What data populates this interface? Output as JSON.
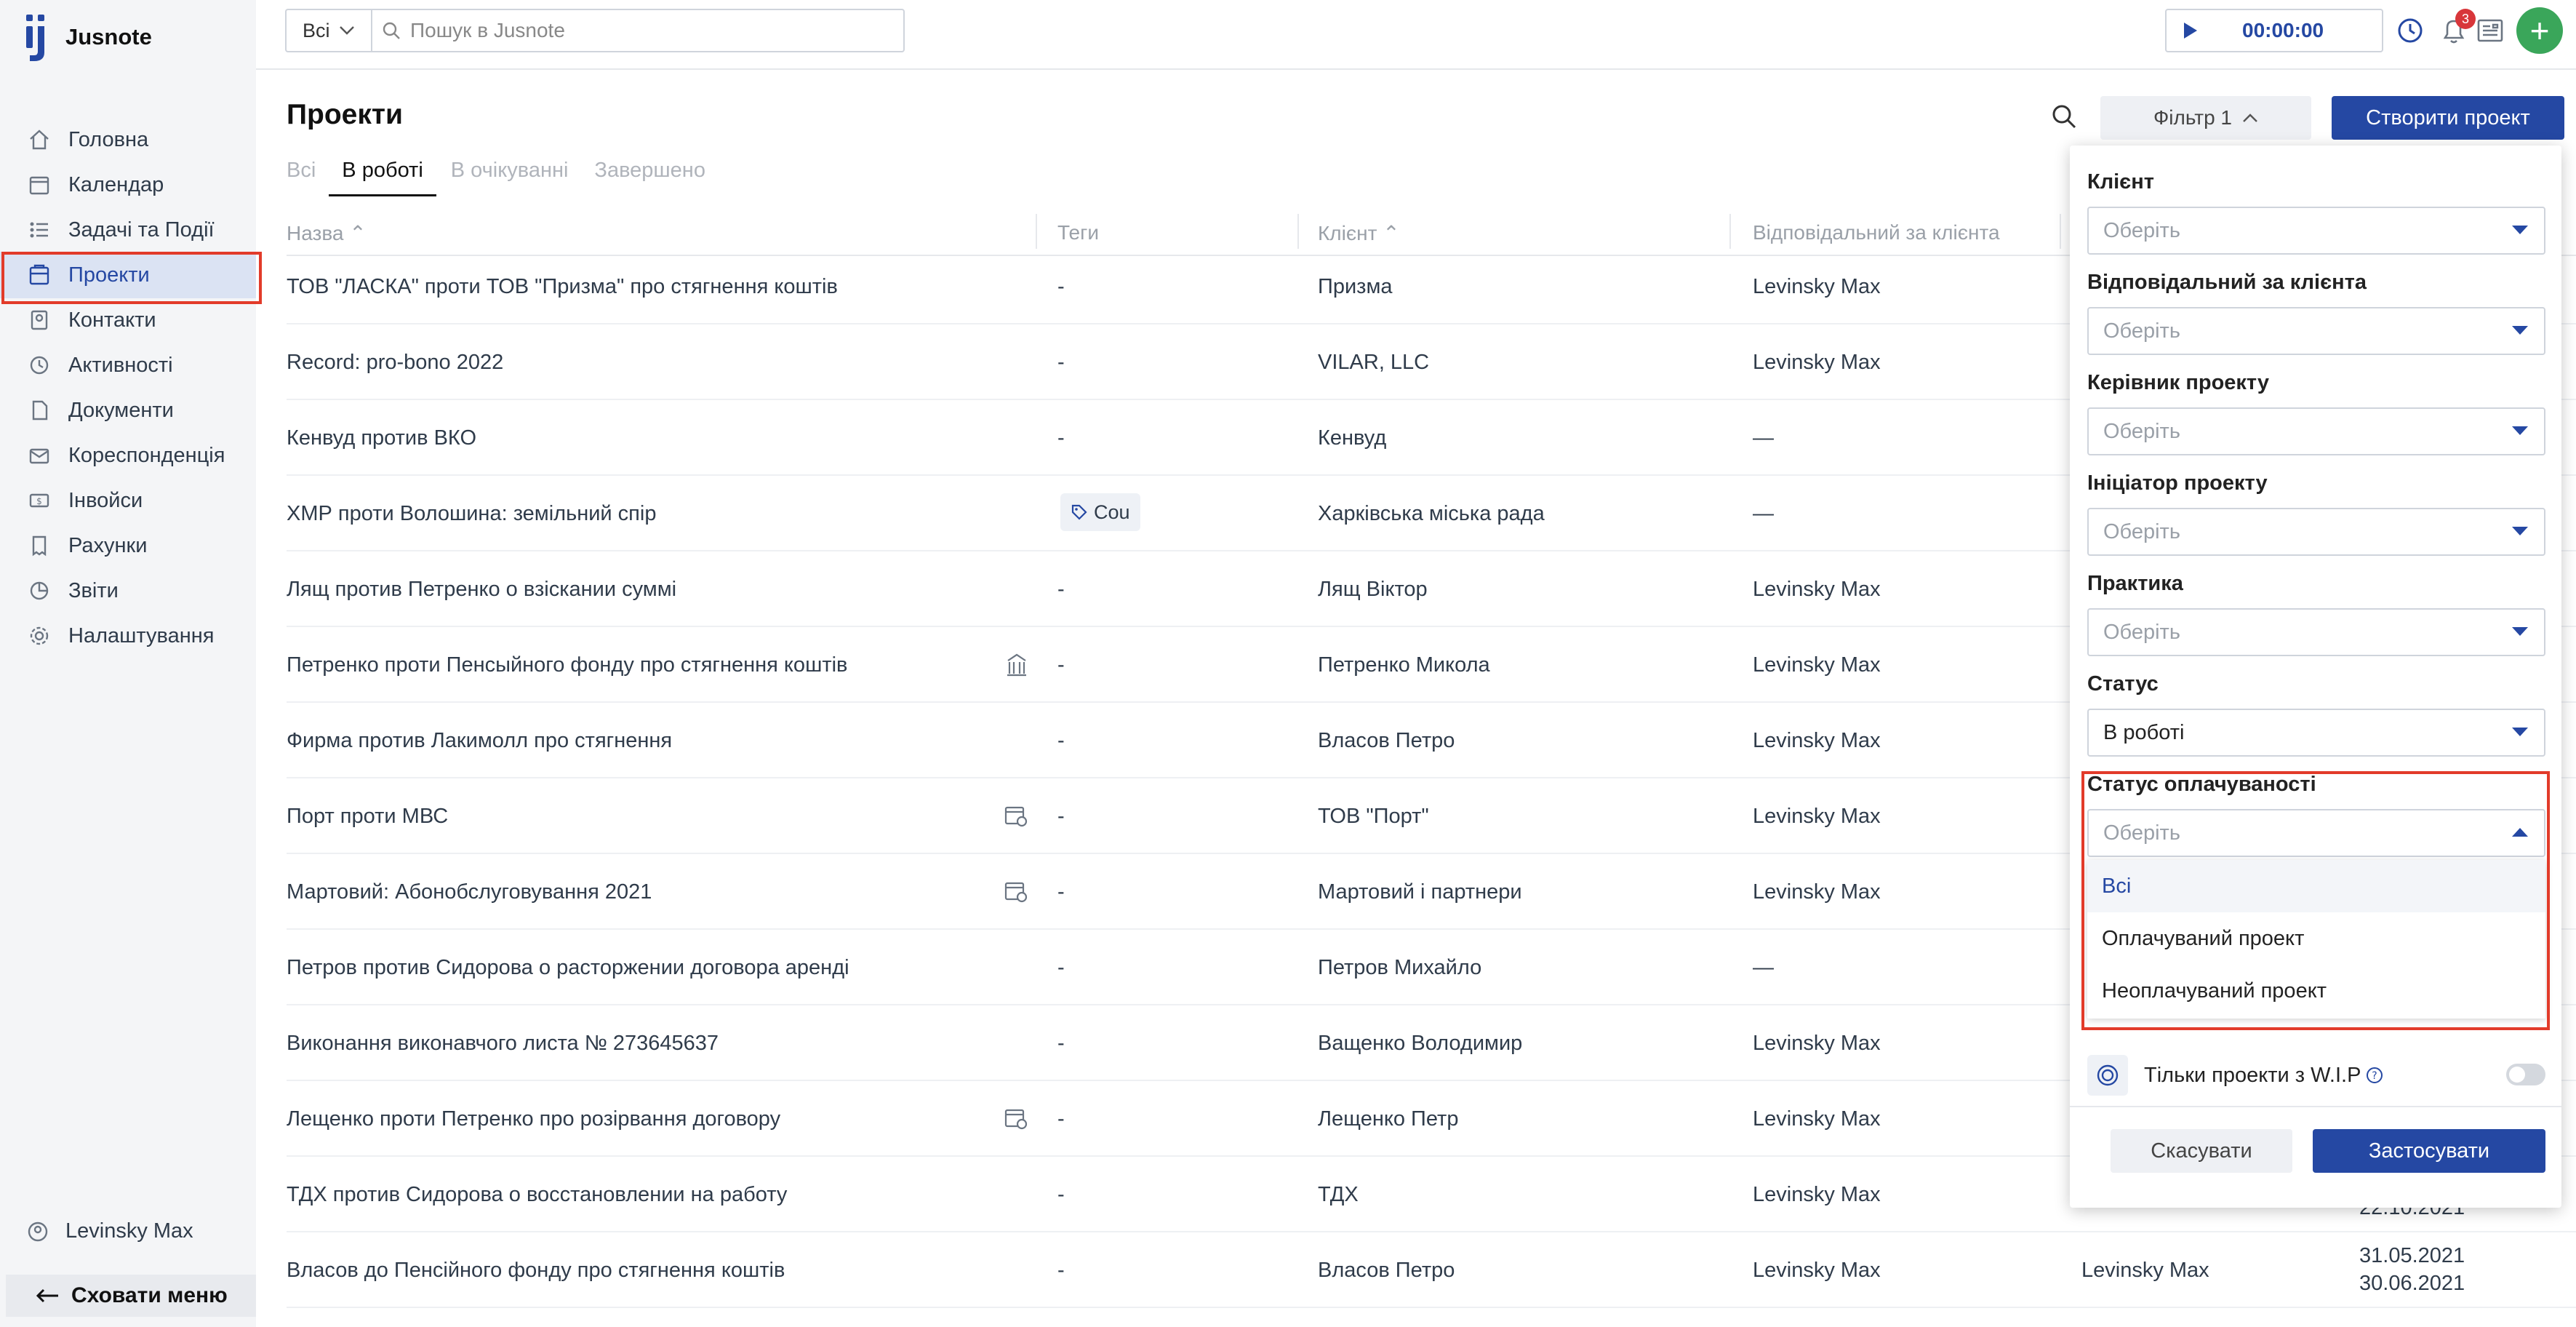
{
  "app": {
    "name": "Jusnote"
  },
  "sidebar": {
    "items": [
      {
        "label": "Головна",
        "icon": "home-icon"
      },
      {
        "label": "Календар",
        "icon": "calendar-icon"
      },
      {
        "label": "Задачі та Події",
        "icon": "tasks-icon"
      },
      {
        "label": "Проекти",
        "icon": "projects-icon"
      },
      {
        "label": "Контакти",
        "icon": "contacts-icon"
      },
      {
        "label": "Активності",
        "icon": "activity-icon"
      },
      {
        "label": "Документи",
        "icon": "documents-icon"
      },
      {
        "label": "Кореспонденція",
        "icon": "mail-icon"
      },
      {
        "label": "Інвойси",
        "icon": "invoice-icon"
      },
      {
        "label": "Рахунки",
        "icon": "bills-icon"
      },
      {
        "label": "Звіти",
        "icon": "reports-icon"
      },
      {
        "label": "Налаштування",
        "icon": "settings-icon"
      }
    ],
    "active": "Проекти",
    "user": "Levinsky Max",
    "hide_menu": "Сховати меню"
  },
  "topbar": {
    "scope": "Всі",
    "search_placeholder": "Пошук в Jusnote",
    "timer": "00:00:00",
    "notifications_count": "3"
  },
  "header": {
    "title": "Проекти",
    "tabs": [
      "Всі",
      "В роботі",
      "В очікуванні",
      "Завершено"
    ],
    "active_tab": "В роботі",
    "filter_label": "Фільтр 1",
    "create_label": "Створити проект"
  },
  "table": {
    "columns": [
      "Назва",
      "Теги",
      "Клієнт",
      "Відповідальний за клієнта"
    ],
    "rows": [
      {
        "name": "ТОВ \"ЛАСКА\" проти ТОВ \"Призма\" про стягнення коштів",
        "tags": "-",
        "client": "Призма",
        "responsible": "Levinsky Max"
      },
      {
        "name": "Record: pro-bono 2022",
        "tags": "-",
        "client": "VILAR, LLC",
        "responsible": "Levinsky Max"
      },
      {
        "name": "Кенвуд против ВКО",
        "tags": "-",
        "client": "Кенвуд",
        "responsible": "—"
      },
      {
        "name": "ХМР проти Волошина: земільний спір",
        "tags": "Cou",
        "client": "Харківська міська рада",
        "responsible": "—"
      },
      {
        "name": "Лящ против Петренко о взіскании суммі",
        "tags": "-",
        "client": "Лящ Віктор",
        "responsible": "Levinsky Max"
      },
      {
        "name": "Петренко проти Пенсыйного фонду про стягнення коштів",
        "tags": "-",
        "client": "Петренко Микола",
        "responsible": "Levinsky Max"
      },
      {
        "name": "Фирма против Лакимолл про стягнення",
        "tags": "-",
        "client": "Власов Петро",
        "responsible": "Levinsky Max"
      },
      {
        "name": "Порт проти МВС",
        "tags": "-",
        "client": "ТОВ \"Порт\"",
        "responsible": "Levinsky Max"
      },
      {
        "name": "Мартовий: Абонобслуговування 2021",
        "tags": "-",
        "client": "Мартовий і партнери",
        "responsible": "Levinsky Max"
      },
      {
        "name": "Петров против Сидорова о расторжении договора аренді",
        "tags": "-",
        "client": "Петров Михайло",
        "responsible": "—"
      },
      {
        "name": "Виконання виконавчого листа № 273645637",
        "tags": "-",
        "client": "Ващенко Володимир",
        "responsible": "Levinsky Max"
      },
      {
        "name": "Лещенко проти Петренко про розірвання договору",
        "tags": "-",
        "client": "Лещенко Петр",
        "responsible": "Levinsky Max"
      },
      {
        "name": "ТДХ против Сидорова о восстановлении на работу",
        "tags": "-",
        "client": "ТДХ",
        "responsible": "Levinsky Max"
      },
      {
        "name": "Власов до Пенсійного фонду про стягнення коштів",
        "tags": "-",
        "client": "Власов Петро",
        "responsible": "Levinsky Max"
      }
    ],
    "peek": {
      "manager_last": "Levinsky Max",
      "date_a": "22.10.2021",
      "date_b": "31.05.2021",
      "date_c": "30.06.2021"
    }
  },
  "filter_panel": {
    "fields": [
      {
        "label": "Клієнт",
        "value": "Оберіть"
      },
      {
        "label": "Відповідальний за клієнта",
        "value": "Оберіть"
      },
      {
        "label": "Керівник проекту",
        "value": "Оберіть"
      },
      {
        "label": "Ініціатор проекту",
        "value": "Оберіть"
      },
      {
        "label": "Практика",
        "value": "Оберіть"
      },
      {
        "label": "Статус",
        "value": "В роботі"
      },
      {
        "label": "Статус оплачуваності",
        "value": "Оберіть"
      }
    ],
    "payment_options": [
      "Всі",
      "Оплачуваний проект",
      "Неоплачуваний проект"
    ],
    "wip_label": "Тільки проекти з W.I.P",
    "cancel_label": "Скасувати",
    "apply_label": "Застосувати"
  },
  "colors": {
    "primary": "#2548a3",
    "highlight": "#e23b2a",
    "add": "#3aa65a"
  }
}
